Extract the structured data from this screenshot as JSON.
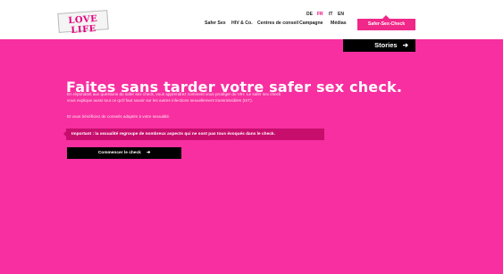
{
  "header": {
    "logo_text": "LOVE LIFE",
    "languages": [
      "DE",
      "FR",
      "IT",
      "EN"
    ],
    "active_language": "FR",
    "nav": [
      "Safer Sex",
      "HIV & Co.",
      "Centres de conseil",
      "Campagne",
      "Médias"
    ],
    "cta_label": "Safer-Sex-Check"
  },
  "hero": {
    "stories_label": "Stories",
    "stories_icon": "arrow-icon",
    "title": "Faites sans tarder votre safer sex check.",
    "paragraph_1_line_1": "En répondant aux questions du safer sex check, vous apprendrez comment vous protéger du VIH. Le safer sex check",
    "paragraph_1_line_2": "vous explique aussi tout ce qu'il faut savoir sur les autres infections sexuellement transmissibles (IST).",
    "paragraph_2": "Et vous bénéficiez de conseils adaptés à votre sexualité.",
    "important_text": "Important : la sexualité regroupe de nombreux aspects qui ne sont pas tous évoqués dans le check.",
    "start_button_label": "Commencer le check",
    "start_button_icon": "arrow-icon"
  },
  "colors": {
    "brand_pink": "#f72fa0",
    "cta_pink": "#f0288a",
    "important_bg": "#c70e6d",
    "black": "#000000"
  }
}
